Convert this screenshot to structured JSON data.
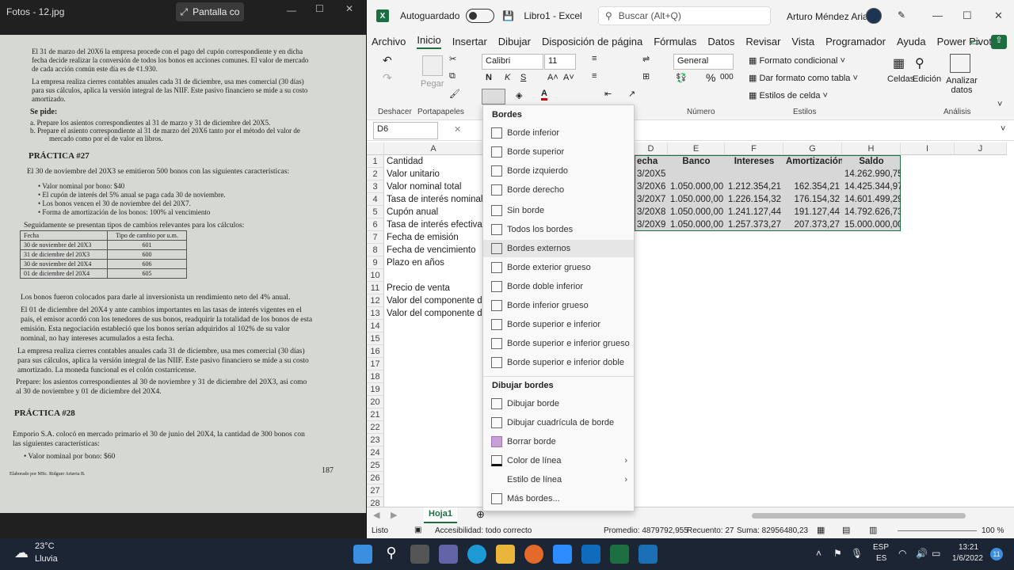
{
  "photos": {
    "title": "Fotos - 12.jpg",
    "pantalla_btn": "Pantalla co",
    "doc": {
      "p1": "El 31 de marzo del 20X6 la empresa procede con el pago del cupón correspondiente y en dicha",
      "p1b": "fecha decide realizar la conversión de todos los bonos en acciones comunes. El valor de mercado",
      "p1c": "de cada acción común este día es de ¢1.930.",
      "p2": "La empresa realiza cierres contables anuales cada 31 de diciembre, usa mes comercial (30 días)",
      "p2b": "para sus cálculos, aplica la versión integral de las NIIF. Este pasivo financiero se mide a su costo",
      "p2c": "amortizado.",
      "sepide": "Se pide:",
      "a": "a.   Prepare los asientos correspondientes al 31 de marzo y 31 de diciembre del 20X5.",
      "b": "b.   Prepare el asiento correspondiente al 31 de marzo del 20X6 tanto por el método del valor de",
      "b2": "mercado como por el de valor en libros.",
      "prac27": "PRÁCTICA #27",
      "p3": "El 30 de noviembre del 20X3 se emitieron 500 bonos con las siguientes características:",
      "bul1": "•   Valor nominal por bono: $40",
      "bul2": "•   El cupón de interés del 5% anual se paga cada 30 de noviembre.",
      "bul3": "•   Los bonos vencen el 30 de noviembre del del 20X7.",
      "bul4": "•   Forma de amortización de los bonos: 100% al vencimiento",
      "p4": "Seguidamente se presentan tipos de cambios relevantes para los cálculos:",
      "th1": "Fecha",
      "th2": "Tipo de cambio por u.m.",
      "rows": [
        [
          "30 de noviembre del 20X3",
          "601"
        ],
        [
          "31 de diciembre del 20X3",
          "600"
        ],
        [
          "30 de noviembre del 20X4",
          "606"
        ],
        [
          "01 de diciembre del 20X4",
          "605"
        ]
      ],
      "p5": "Los bonos fueron colocados para darle al inversionista un rendimiento neto del 4% anual.",
      "p6": "El 01 de diciembre del 20X4 y ante cambios importantes en las tasas de interés vigentes en el",
      "p6b": "país, el emisor acordó con los tenedores de sus bonos, readquirir la totalidad de los bonos de esta",
      "p6c": "emisión. Esta negociación estableció que los bonos serían adquiridos al 102% de su valor",
      "p6d": "nominal, no hay intereses acumulados a esta fecha.",
      "p7": "La empresa realiza cierres contables anuales cada 31 de diciembre, usa mes comercial (30 días)",
      "p7b": "para sus cálculos, aplica la versión integral de las NIIF. Este pasivo financiero se mide a su costo",
      "p7c": "amortizado. La moneda funcional es el colón costarricense.",
      "p8": "Prepare: los asientos correspondientes al 30 de noviembre y 31 de diciembre del 20X3, así como",
      "p8b": "al 30 de noviembre y 01 de diciembre del 20X4.",
      "prac28": "PRÁCTICA #28",
      "p9": "Emporio S.A. colocó en mercado primario el 30 de junio del 20X4, la cantidad de 300 bonos con",
      "p9b": "las siguientes características:",
      "bul5": "•   Valor nominal por bono: $60",
      "footer": "Elaborado por MSc. Ridguer Artavia B.",
      "page": "187"
    }
  },
  "excel": {
    "autosave": "Autoguardado",
    "filename": "Libro1  -  Excel",
    "search": "Buscar (Alt+Q)",
    "user": "Arturo Méndez Arias",
    "menu": [
      "Archivo",
      "Inicio",
      "Insertar",
      "Dibujar",
      "Disposición de página",
      "Fórmulas",
      "Datos",
      "Revisar",
      "Vista",
      "Programador",
      "Ayuda",
      "Power Pivot"
    ],
    "ribbon": {
      "deshacer": "Deshacer",
      "portapapeles": "Portapapeles",
      "pegar": "Pegar",
      "font": "Calibri",
      "size": "11",
      "bold": "N",
      "italic": "K",
      "underline": "S",
      "numero": "Número",
      "general": "General",
      "formato_condicional": "Formato condicional",
      "dar_formato": "Dar formato como tabla",
      "estilos_celda": "Estilos de celda",
      "estilos": "Estilos",
      "celdas": "Celdas",
      "edicion": "Edición",
      "analizar": "Analizar datos",
      "analisis": "Análisis"
    },
    "namebox": "D6",
    "cols": [
      "A",
      "D",
      "E",
      "F",
      "G",
      "H",
      "I",
      "J"
    ],
    "headers": {
      "D": "echa",
      "E": "Banco",
      "F": "Intereses",
      "G": "Amortización",
      "H": "Saldo"
    },
    "colA": [
      "Cantidad",
      "Valor unitario",
      "Valor nominal total",
      "Tasa de interés nominal",
      "Cupón anual",
      "Tasa de interés efectiva",
      "Fecha de emisión",
      "Fecha de vencimiento",
      "Plazo en años",
      "",
      "Precio de venta",
      "Valor del componente de",
      "Valor del componente de"
    ],
    "table": [
      [
        "3/20X5",
        "",
        "",
        "",
        "14.262.990,75"
      ],
      [
        "3/20X6",
        "1.050.000,00",
        "1.212.354,21",
        "162.354,21",
        "14.425.344,97"
      ],
      [
        "3/20X7",
        "1.050.000,00",
        "1.226.154,32",
        "176.154,32",
        "14.601.499,29"
      ],
      [
        "3/20X8",
        "1.050.000,00",
        "1.241.127,44",
        "191.127,44",
        "14.792.626,73"
      ],
      [
        "3/20X9",
        "1.050.000,00",
        "1.257.373,27",
        "207.373,27",
        "15.000.000,00"
      ]
    ],
    "sheet": "Hoja1",
    "status": {
      "listo": "Listo",
      "accesibilidad": "Accesibilidad: todo correcto",
      "promedio": "Promedio: 4879792,955",
      "recuento": "Recuento: 27",
      "suma": "Suma: 82956480,23",
      "zoom": "100 %"
    }
  },
  "dropdown": {
    "bordes": "Bordes",
    "items": [
      "Borde inferior",
      "Borde superior",
      "Borde izquierdo",
      "Borde derecho",
      "Sin borde",
      "Todos los bordes",
      "Bordes externos",
      "Borde exterior grueso",
      "Borde doble inferior",
      "Borde inferior grueso",
      "Borde superior e inferior",
      "Borde superior e inferior grueso",
      "Borde superior e inferior doble"
    ],
    "dibujar": "Dibujar bordes",
    "draw_items": [
      "Dibujar borde",
      "Dibujar cuadrícula de borde",
      "Borrar borde",
      "Color de línea",
      "Estilo de línea",
      "Más bordes..."
    ]
  },
  "taskbar": {
    "temp": "23°C",
    "weather": "Lluvia",
    "lang1": "ESP",
    "lang2": "ES",
    "time": "13:21",
    "date": "1/6/2022",
    "badge": "11"
  }
}
